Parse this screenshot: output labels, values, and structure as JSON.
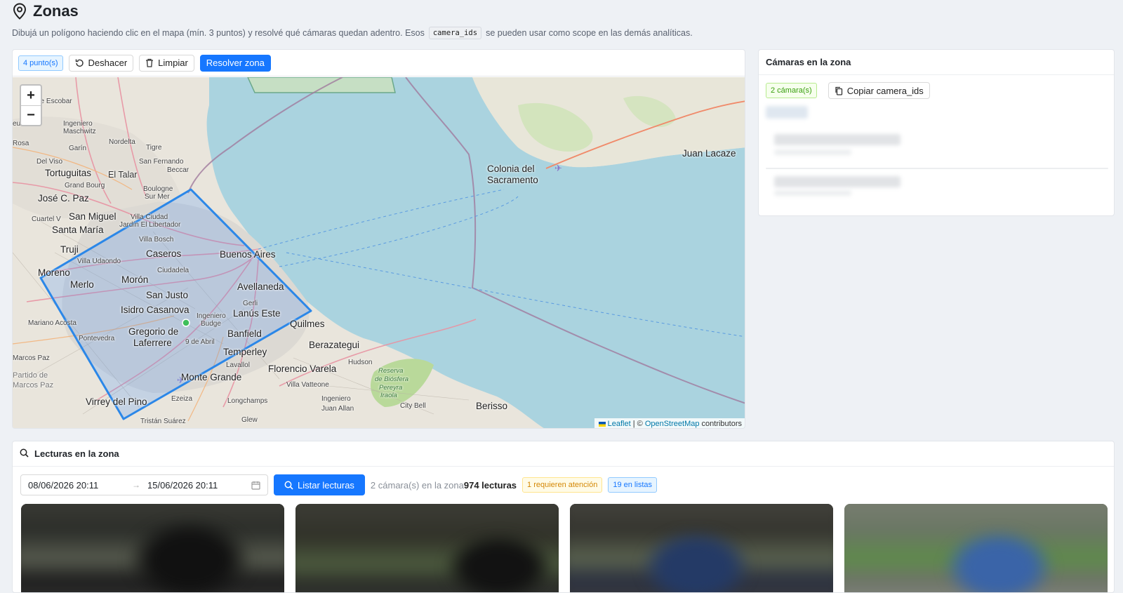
{
  "page": {
    "title": "Zonas",
    "subtitle_before": "Dibujá un polígono haciendo clic en el mapa (mín. 3 puntos) y resolvé qué cámaras quedan adentro. Esos",
    "subtitle_code": "camera_ids",
    "subtitle_after": "se pueden usar como scope en las demás analíticas."
  },
  "map_toolbar": {
    "points_tag": "4 punto(s)",
    "undo_label": "Deshacer",
    "clear_label": "Limpiar",
    "resolve_label": "Resolver zona"
  },
  "map": {
    "zoom_in": "+",
    "zoom_out": "−",
    "attribution_leaflet": "Leaflet",
    "attribution_sep": " | © ",
    "attribution_osm": "OpenStreetMap",
    "attribution_tail": " contributors",
    "labels": [
      {
        "text": "de Escobar",
        "cls": "small"
      },
      {
        "text": "eu",
        "cls": "small"
      },
      {
        "text": "Ingeniero",
        "cls": "small"
      },
      {
        "text": "Maschwitz",
        "cls": "small"
      },
      {
        "text": "Rosa",
        "cls": "small"
      },
      {
        "text": "Garín",
        "cls": "small"
      },
      {
        "text": "Nordelta",
        "cls": "small"
      },
      {
        "text": "Tigre",
        "cls": "small"
      },
      {
        "text": "Del Viso",
        "cls": "small"
      },
      {
        "text": "San Fernando",
        "cls": "small"
      },
      {
        "text": "Beccar",
        "cls": "small"
      },
      {
        "text": "Tortuguitas",
        "cls": "big"
      },
      {
        "text": "El Talar",
        "cls": ""
      },
      {
        "text": "Grand Bourg",
        "cls": "small"
      },
      {
        "text": "Boulogne",
        "cls": "small"
      },
      {
        "text": "Sur Mer",
        "cls": "small"
      },
      {
        "text": "José C. Paz",
        "cls": "big"
      },
      {
        "text": "Villa Ciudad",
        "cls": "small"
      },
      {
        "text": "Jardín El Libertador",
        "cls": "small"
      },
      {
        "text": "San Miguel",
        "cls": "big"
      },
      {
        "text": "Cuartel V",
        "cls": "small"
      },
      {
        "text": "Santa María",
        "cls": "big"
      },
      {
        "text": "Villa Bosch",
        "cls": "small"
      },
      {
        "text": "Truji",
        "cls": "big"
      },
      {
        "text": "Caseros",
        "cls": "big"
      },
      {
        "text": "Buenos Aires",
        "cls": "big"
      },
      {
        "text": "Villa Udaondo",
        "cls": "small"
      },
      {
        "text": "Ciudadela",
        "cls": "small"
      },
      {
        "text": "Moreno",
        "cls": "big"
      },
      {
        "text": "Morón",
        "cls": "big"
      },
      {
        "text": "Merlo",
        "cls": "big"
      },
      {
        "text": "Avellaneda",
        "cls": "big"
      },
      {
        "text": "San Justo",
        "cls": "big"
      },
      {
        "text": "Gerli",
        "cls": "small"
      },
      {
        "text": "Isidro Casanova",
        "cls": "big"
      },
      {
        "text": "Ingeniero",
        "cls": "small"
      },
      {
        "text": "Budge",
        "cls": "small"
      },
      {
        "text": "Lanús Este",
        "cls": "big"
      },
      {
        "text": "Mariano Acosta",
        "cls": "small"
      },
      {
        "text": "Quilmes",
        "cls": "big"
      },
      {
        "text": "Gregorio de",
        "cls": "big"
      },
      {
        "text": "Laferrere",
        "cls": "big"
      },
      {
        "text": "Banfield",
        "cls": "big"
      },
      {
        "text": "Pontevedra",
        "cls": "small"
      },
      {
        "text": "9 de Abril",
        "cls": "small"
      },
      {
        "text": "Berazategui",
        "cls": "big"
      },
      {
        "text": "Temperley",
        "cls": "big"
      },
      {
        "text": "Marcos Paz",
        "cls": "small"
      },
      {
        "text": "Hudson",
        "cls": "small"
      },
      {
        "text": "Lavallol",
        "cls": "small"
      },
      {
        "text": "Florencio Varela",
        "cls": "big"
      },
      {
        "text": "Partido de",
        "cls": "grey"
      },
      {
        "text": "Marcos Paz",
        "cls": "grey"
      },
      {
        "text": "Reserva",
        "cls": "green"
      },
      {
        "text": "de Biósfera",
        "cls": "green"
      },
      {
        "text": "Pereyra",
        "cls": "green"
      },
      {
        "text": "Iraola",
        "cls": "green"
      },
      {
        "text": "Monte Grande",
        "cls": "big"
      },
      {
        "text": "Villa Vatteone",
        "cls": "small"
      },
      {
        "text": "Ezeiza",
        "cls": "small"
      },
      {
        "text": "Longchamps",
        "cls": "small"
      },
      {
        "text": "Ingeniero",
        "cls": "small"
      },
      {
        "text": "Juan Allan",
        "cls": "small"
      },
      {
        "text": "City Bell",
        "cls": "small"
      },
      {
        "text": "Berisso",
        "cls": "big"
      },
      {
        "text": "Virrey del Pino",
        "cls": "big"
      },
      {
        "text": "Tristán Suárez",
        "cls": "small"
      },
      {
        "text": "Glew",
        "cls": "small"
      },
      {
        "text": "Colonia del",
        "cls": "big"
      },
      {
        "text": "Sacramento",
        "cls": "big"
      },
      {
        "text": "Juan Lacaze",
        "cls": "big"
      }
    ]
  },
  "cameras_panel": {
    "title": "Cámaras en la zona",
    "count_tag": "2 cámara(s)",
    "copy_label": "Copiar camera_ids"
  },
  "readings": {
    "title": "Lecturas en la zona",
    "date_from": "08/06/2026 20:11",
    "date_arrow": "→",
    "date_to": "15/06/2026 20:11",
    "list_button": "Listar lecturas",
    "cams_in_zone": "2 cámara(s) en la zona",
    "total_readings": "974 lecturas",
    "attention_tag": "1 requieren atención",
    "lists_tag": "19 en listas"
  },
  "colors": {
    "primary": "#1677ff",
    "water": "#aad3df",
    "land": "#e9e5dc",
    "polygon": "#2b87e8"
  }
}
